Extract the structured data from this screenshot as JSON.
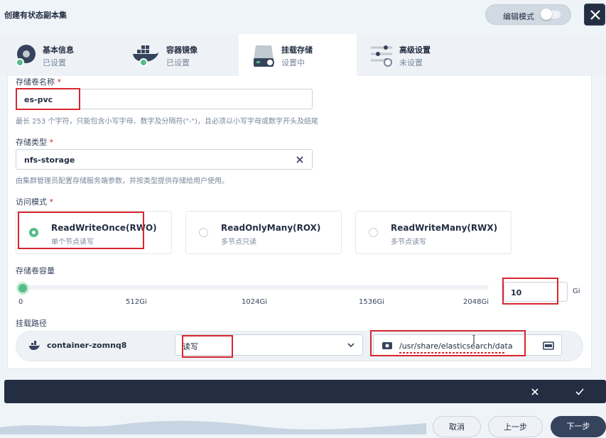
{
  "header": {
    "title": "创建有状态副本集",
    "edit_mode_label": "编辑模式"
  },
  "tabs": [
    {
      "title": "基本信息",
      "status": "已设置",
      "icon": "disk-icon"
    },
    {
      "title": "容器镜像",
      "status": "已设置",
      "icon": "docker-icon"
    },
    {
      "title": "挂载存储",
      "status": "设置中",
      "icon": "storage-icon"
    },
    {
      "title": "高级设置",
      "status": "未设置",
      "icon": "sliders-icon"
    }
  ],
  "form": {
    "volume_name_label": "存储卷名称",
    "volume_name_value": "es-pvc",
    "volume_name_hint": "最长 253 个字符，只能包含小写字母、数字及分隔符(\"-\")，且必须以小写字母或数字开头及结尾",
    "storage_class_label": "存储类型",
    "storage_class_value": "nfs-storage",
    "storage_class_hint": "由集群管理员配置存储服务端参数，并按类型提供存储给用户使用。",
    "access_mode_label": "访问模式",
    "access_modes": [
      {
        "title": "ReadWriteOnce(RWO)",
        "desc": "单个节点读写",
        "selected": true
      },
      {
        "title": "ReadOnlyMany(ROX)",
        "desc": "多节点只读",
        "selected": false
      },
      {
        "title": "ReadWriteMany(RWX)",
        "desc": "多节点读写",
        "selected": false
      }
    ],
    "capacity_label": "存储卷容量",
    "capacity_ticks": [
      "0",
      "512Gi",
      "1024Gi",
      "1536Gi",
      "2048Gi"
    ],
    "capacity_value": "10",
    "capacity_unit": "Gi",
    "slider_fraction": 0.005,
    "mount_path_label": "挂载路径",
    "container_name": "container-zomnq8",
    "mount_mode": "读写",
    "mount_path": "/usr/share/elasticsearch/data"
  },
  "footer": {
    "cancel": "取消",
    "prev": "上一步",
    "next": "下一步"
  },
  "colors": {
    "accent": "#55bc8a",
    "dark": "#242e42",
    "highlight": "#d7262e"
  }
}
